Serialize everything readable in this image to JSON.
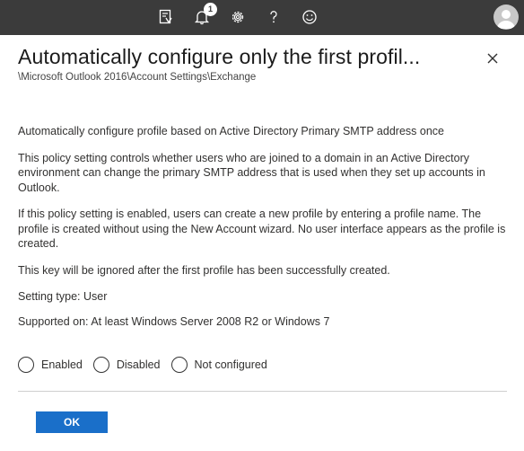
{
  "topbar": {
    "icons": [
      "policy-report-icon",
      "bell-icon",
      "gear-icon",
      "help-icon",
      "smiley-icon",
      "avatar-icon"
    ],
    "notification_count": "1"
  },
  "header": {
    "title": "Automatically configure only the first profil...",
    "breadcrumb": "\\Microsoft Outlook 2016\\Account Settings\\Exchange",
    "close_icon": "close-icon"
  },
  "body": {
    "summary": "Automatically configure profile based on Active Directory Primary SMTP address once",
    "description_1": "This policy setting controls whether users who are joined to a domain in an Active Directory environment can change the primary SMTP address that is used when they set up accounts in Outlook.",
    "description_2": "If this policy setting is enabled, users can create a new profile by entering a profile name. The profile is created without using the New Account wizard. No user interface appears as the profile is created.",
    "description_3": "This key will be ignored after the first profile has been successfully created.",
    "setting_type": "Setting type: User",
    "supported_on": "Supported on: At least Windows Server 2008 R2 or Windows 7"
  },
  "options": {
    "enabled": "Enabled",
    "disabled": "Disabled",
    "not_configured": "Not configured"
  },
  "footer": {
    "ok_label": "OK"
  },
  "colors": {
    "topbar": "#3b3b3b",
    "primary_button": "#1a6fc9"
  }
}
